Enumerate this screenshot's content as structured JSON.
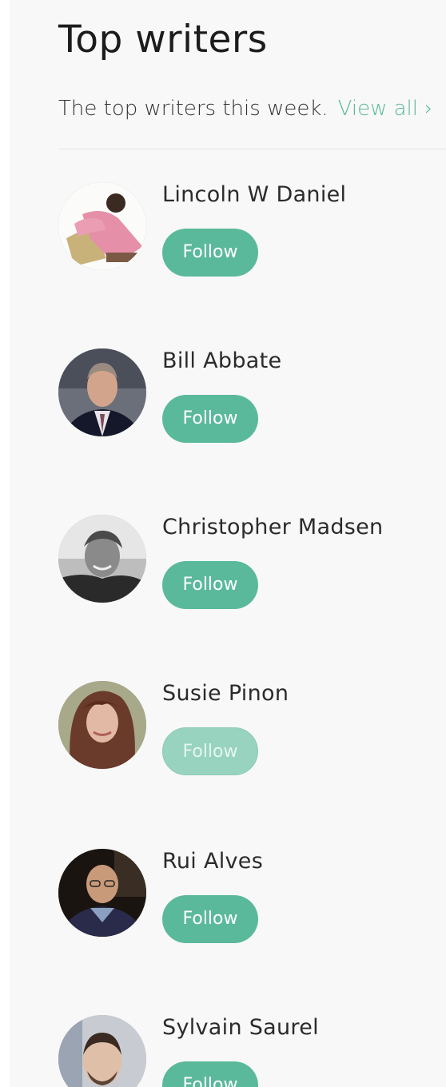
{
  "header": {
    "title": "Top writers",
    "subtitle": "The top writers this week.",
    "view_all_label": "View all",
    "chevron_glyph": "›"
  },
  "colors": {
    "accent": "#5bb99b",
    "accent_faded": "#98d3bf",
    "panel_background": "#f8f8f8"
  },
  "writers": [
    {
      "name": "Lincoln W Daniel",
      "follow_label": "Follow",
      "follow_state": "active",
      "avatar_icon": "avatar-photo-man-pink-shirt"
    },
    {
      "name": "Bill Abbate",
      "follow_label": "Follow",
      "follow_state": "active",
      "avatar_icon": "avatar-photo-man-suit"
    },
    {
      "name": "Christopher Madsen",
      "follow_label": "Follow",
      "follow_state": "active",
      "avatar_icon": "avatar-photo-man-grayscale"
    },
    {
      "name": "Susie Pinon",
      "follow_label": "Follow",
      "follow_state": "disabled",
      "avatar_icon": "avatar-photo-woman"
    },
    {
      "name": "Rui Alves",
      "follow_label": "Follow",
      "follow_state": "active",
      "avatar_icon": "avatar-photo-man-glasses"
    },
    {
      "name": "Sylvain Saurel",
      "follow_label": "Follow",
      "follow_state": "active",
      "avatar_icon": "avatar-photo-man-beard"
    }
  ]
}
